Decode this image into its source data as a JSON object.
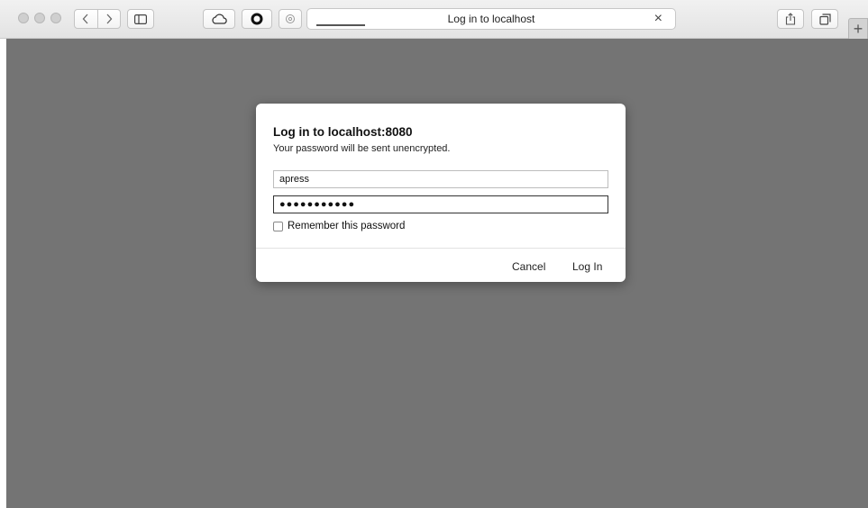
{
  "toolbar": {
    "tab_title": "Log in to localhost",
    "close_glyph": "×",
    "new_tab_glyph": "+",
    "icons": [
      "traffic-light-close",
      "traffic-light-minimize",
      "traffic-light-zoom",
      "back",
      "forward",
      "sidebar",
      "cloud",
      "opera",
      "settings",
      "share",
      "tabs-overview"
    ]
  },
  "dialog": {
    "title": "Log in to localhost:8080",
    "subtitle": "Your password will be sent unencrypted.",
    "username_value": "apress",
    "password_masked": "●●●●●●●●●●●",
    "remember_label": "Remember this password",
    "remember_checked": false,
    "cancel_label": "Cancel",
    "login_label": "Log In"
  },
  "colors": {
    "content_background": "#747474",
    "dialog_background": "#ffffff"
  }
}
